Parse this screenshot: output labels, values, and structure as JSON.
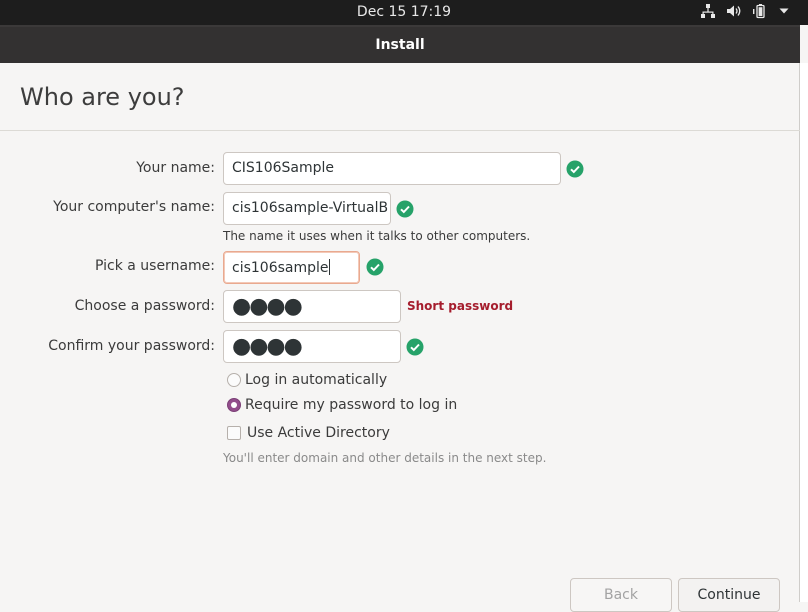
{
  "topbar": {
    "datetime": "Dec 15  17:19",
    "icons": [
      "network-icon",
      "volume-icon",
      "battery-icon",
      "system-menu-chevron-icon"
    ]
  },
  "window": {
    "title": "Install"
  },
  "page": {
    "heading": "Who are you?"
  },
  "form": {
    "name": {
      "label": "Your name:",
      "value": "CIS106Sample",
      "valid": true
    },
    "computer": {
      "label": "Your computer's name:",
      "value": "cis106sample-VirtualB",
      "valid": true,
      "hint": "The name it uses when it talks to other computers."
    },
    "username": {
      "label": "Pick a username:",
      "value": "cis106sample",
      "valid": true
    },
    "password": {
      "label": "Choose a password:",
      "value": "●●●●",
      "status": "Short password"
    },
    "confirm": {
      "label": "Confirm your password:",
      "value": "●●●●",
      "valid": true
    }
  },
  "options": {
    "login_auto": {
      "label": "Log in automatically",
      "selected": false
    },
    "require_password": {
      "label": "Require my password to log in",
      "selected": true
    },
    "active_directory": {
      "label": "Use Active Directory",
      "checked": false
    },
    "ad_hint": "You'll enter domain and other details in the next step."
  },
  "buttons": {
    "back": "Back",
    "continue": "Continue"
  },
  "colors": {
    "valid": "#26a269",
    "error": "#a51d2d",
    "accent": "#924d8b",
    "focus": "#e9a98f"
  }
}
